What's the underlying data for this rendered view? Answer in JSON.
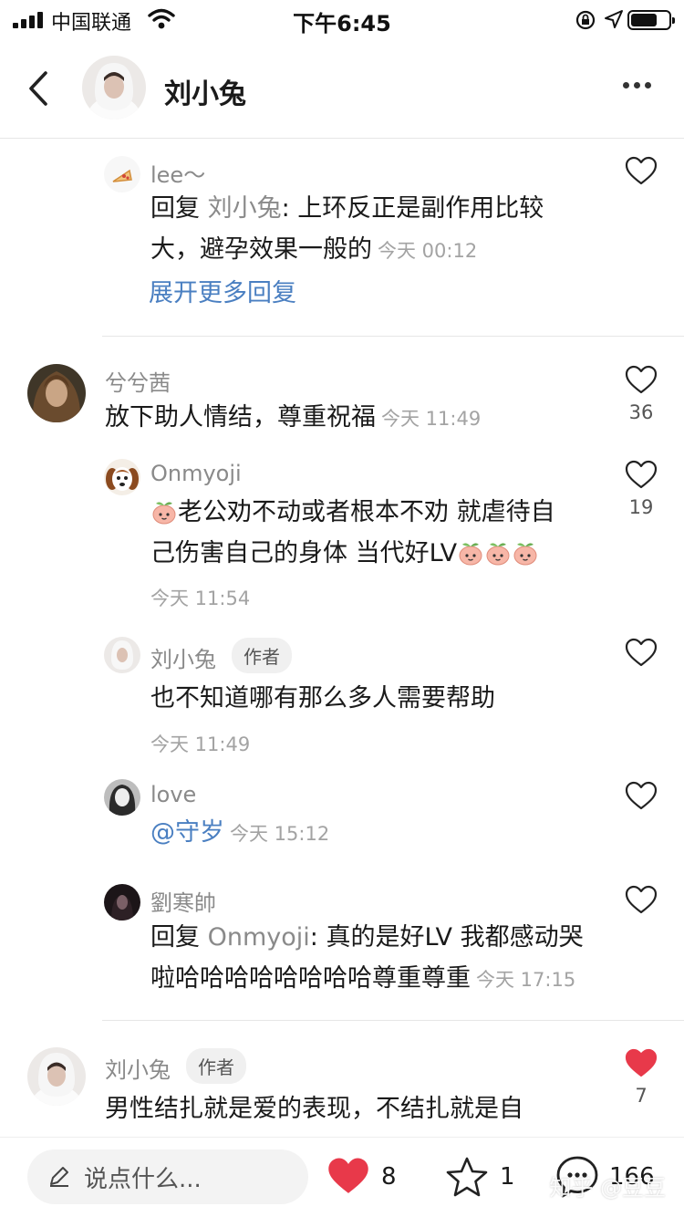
{
  "status_bar": {
    "carrier": "中国联通",
    "time": "下午6:45"
  },
  "header": {
    "title": "刘小兔"
  },
  "comments": [
    {
      "user": "lee～",
      "reply_prefix": "回复 ",
      "reply_to": "刘小兔",
      "text_line1": ": 上环反正是副作用比较",
      "text_line2": "大，避孕效果一般的",
      "time": "今天 00:12",
      "expand_label": "展开更多回复"
    },
    {
      "user": "兮兮茜",
      "text": "放下助人情结，尊重祝福",
      "time": "今天 11:49",
      "likes": "36"
    },
    {
      "user": "Onmyoji",
      "text_line1": "老公劝不动或者根本不劝 就虐待自",
      "text_line2": "己伤害自己的身体 当代好LV",
      "time": "今天 11:54",
      "likes": "19"
    },
    {
      "user": "刘小兔",
      "badge": "作者",
      "text": "也不知道哪有那么多人需要帮助",
      "time": "今天 11:49"
    },
    {
      "user": "love",
      "text": "@守岁",
      "time": "今天 15:12"
    },
    {
      "user": "劉寒帥",
      "reply_prefix": "回复 ",
      "reply_to": "Onmyoji",
      "text_line1": ": 真的是好LV 我都感动哭",
      "text_line2": "啦哈哈哈哈哈哈哈哈尊重尊重",
      "time": "今天 17:15"
    },
    {
      "user": "刘小兔",
      "badge": "作者",
      "text": "男性结扎就是爱的表现，不结扎就是自",
      "likes": "7"
    }
  ],
  "bottom_bar": {
    "placeholder": "说点什么...",
    "like_count": "8",
    "star_count": "1",
    "comment_count": "166"
  },
  "watermark": "知乎 @豆豆",
  "colors": {
    "link": "#4a7fc1",
    "like_red": "#e8394a",
    "text": "#1a1a1a",
    "meta": "#a3a3a3"
  },
  "icons": [
    "signal-icon",
    "wifi-icon",
    "battery-icon",
    "back-arrow-icon",
    "more-icon",
    "heart-icon",
    "heart-filled-icon",
    "peach-emoji-icon",
    "pen-icon",
    "star-icon",
    "comment-icon"
  ]
}
